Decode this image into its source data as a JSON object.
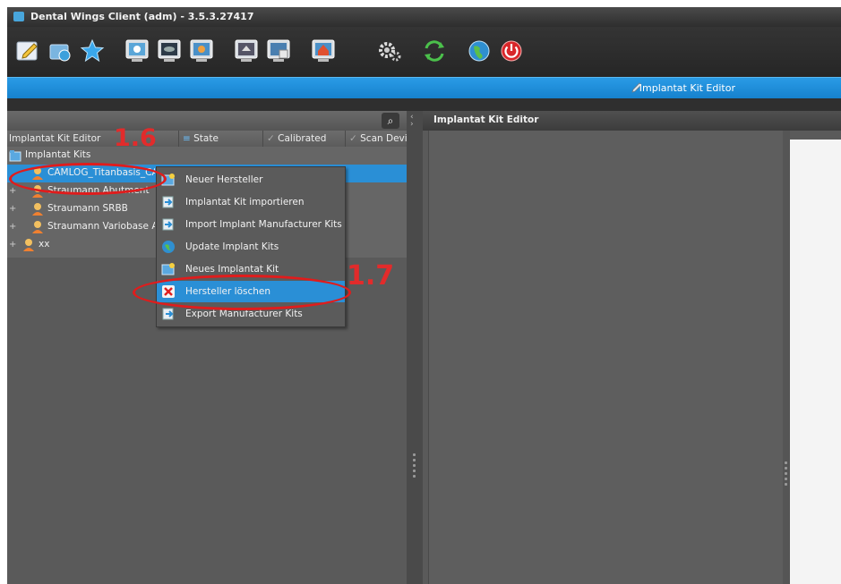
{
  "window": {
    "title": "Dental Wings Client (adm) - 3.5.3.27417"
  },
  "toolbar": {
    "icons": [
      "edit-case-icon",
      "open-case-icon",
      "favorites-star-icon",
      "scanner-icon",
      "monitor-icon",
      "monitor-settings-icon",
      "monitor-upload-icon",
      "monitor-export-icon",
      "monitor-home-icon",
      "settings-gear-icon",
      "sync-arrows-icon",
      "globe-icon",
      "power-icon"
    ]
  },
  "bluebar": {
    "editor_label": "Implantat Kit Editor"
  },
  "left_panel": {
    "columns": [
      "Implantat Kit Editor",
      "State",
      "Calibrated",
      "Scan Devi"
    ],
    "root": "Implantat Kits",
    "items": [
      {
        "label": "CAMLOG_Titanbasis_CA"
      },
      {
        "label": "Straumann Abutment"
      },
      {
        "label": "Straumann SRBB"
      },
      {
        "label": "Straumann Variobase Al"
      },
      {
        "label": "xx"
      }
    ]
  },
  "right_panel": {
    "title": "Implantat Kit Editor"
  },
  "context_menu": {
    "items": [
      {
        "label": "Neuer Hersteller"
      },
      {
        "label": "Implantat Kit importieren"
      },
      {
        "label": "Import Implant Manufacturer Kits"
      },
      {
        "label": "Update Implant Kits"
      },
      {
        "label": "Neues Implantat Kit"
      },
      {
        "label": "Hersteller löschen"
      },
      {
        "label": "Export Manufacturer Kits"
      }
    ]
  },
  "annotations": {
    "step_a": "1.6",
    "step_b": "1.7",
    "color": "#e01c1c"
  }
}
